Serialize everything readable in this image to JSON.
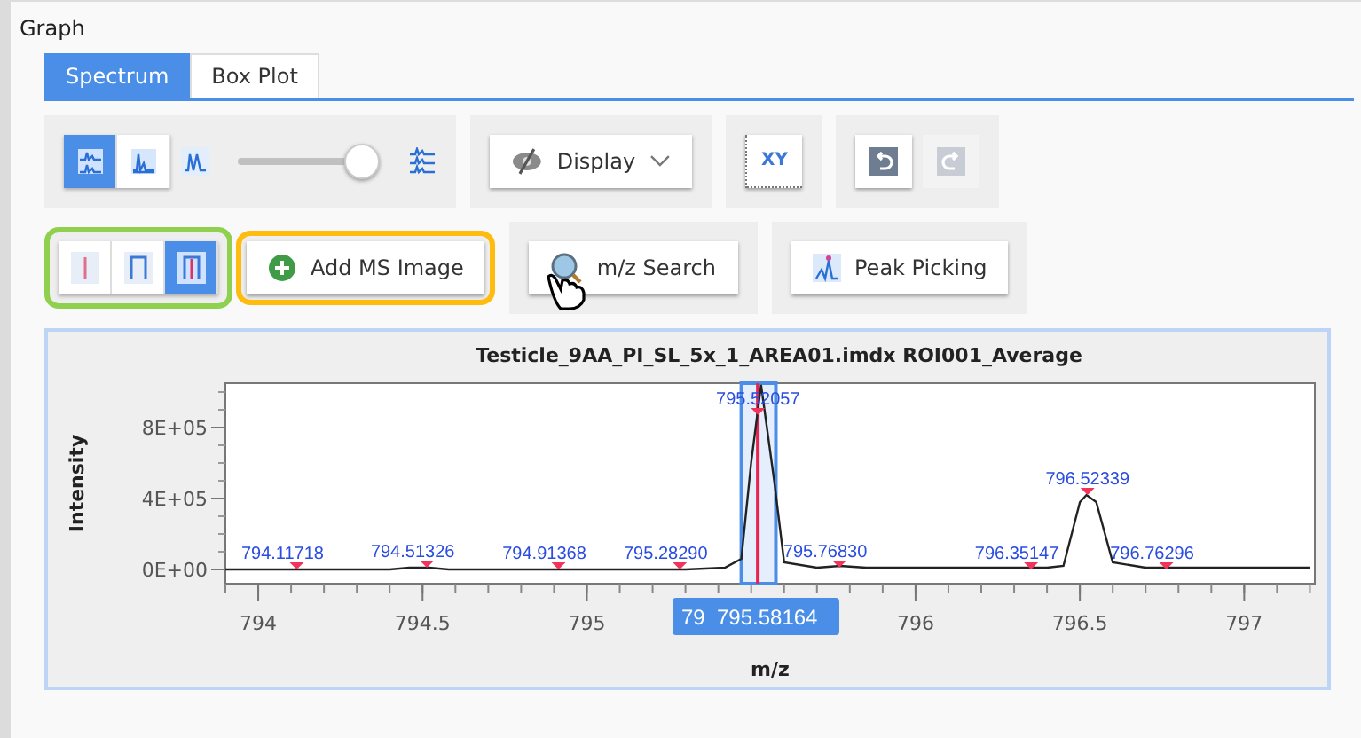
{
  "panel": {
    "title": "Graph"
  },
  "tabs": [
    {
      "label": "Spectrum",
      "selected": true
    },
    {
      "label": "Box Plot",
      "selected": false
    }
  ],
  "toolbar": {
    "view_toggles": [
      {
        "selected": true
      },
      {
        "selected": false
      }
    ],
    "display_button": {
      "label": "Display"
    },
    "axis_button": {
      "label": "XY"
    },
    "undo": {
      "disabled": false
    },
    "redo": {
      "disabled": true
    }
  },
  "mode_group": {
    "highlighted": true,
    "toggles": [
      {
        "selected": false
      },
      {
        "selected": false
      },
      {
        "selected": true
      }
    ]
  },
  "actions": [
    {
      "label": "Add MS Image",
      "highlighted": true
    },
    {
      "label": "m/z Search",
      "highlighted": false
    },
    {
      "label": "Peak Picking",
      "highlighted": false
    }
  ],
  "chart": {
    "cursor_labels": [
      "79",
      "795.58164"
    ],
    "chart_data": {
      "type": "line",
      "title": "Testicle_9AA_PI_SL_5x_1_AREA01.imdx ROI001_Average",
      "xlabel": "m/z",
      "ylabel": "Intensity",
      "x": [
        793.9,
        794.4,
        794.46,
        794.52,
        794.58,
        795.0,
        795.3,
        795.42,
        795.47,
        795.5,
        795.53,
        795.57,
        795.6,
        795.7,
        795.77,
        795.85,
        796.05,
        796.2,
        796.4,
        796.45,
        796.5,
        796.52,
        796.55,
        796.6,
        796.7,
        796.9,
        797.05,
        797.2
      ],
      "series": [
        {
          "color": "#222222",
          "values": [
            0,
            0,
            10000,
            10000,
            0,
            0,
            0,
            10000,
            60000,
            600000,
            1040000,
            500000,
            40000,
            10000,
            20000,
            10000,
            10000,
            10000,
            10000,
            20000,
            380000,
            420000,
            380000,
            40000,
            10000,
            10000,
            10000,
            10000
          ]
        }
      ],
      "xlim": [
        793.9,
        797.215
      ],
      "ylim": [
        -80000,
        1050000
      ],
      "xticks": [
        794,
        794.5,
        795,
        796,
        796.5,
        797
      ],
      "ref_lines": [
        {
          "axis": "x",
          "value": 795.52,
          "color": "#e8244e"
        }
      ],
      "yticks": [
        {
          "value": 0,
          "label": "0E+00"
        },
        {
          "value": 400000,
          "label": "4E+05"
        },
        {
          "value": 800000,
          "label": "8E+05"
        }
      ],
      "annotations": [
        {
          "x": 794.11718,
          "y": 0,
          "text": "794.11718"
        },
        {
          "x": 794.51326,
          "y": 10000,
          "text": "794.51326"
        },
        {
          "x": 794.91368,
          "y": 0,
          "text": "794.91368"
        },
        {
          "x": 795.2829,
          "y": 0,
          "text": "795.28290"
        },
        {
          "x": 795.52057,
          "y": 870000,
          "text": "795.52057"
        },
        {
          "x": 795.7683,
          "y": 10000,
          "text": "795.76830"
        },
        {
          "x": 796.35147,
          "y": 0,
          "text": "796.35147"
        },
        {
          "x": 796.52339,
          "y": 420000,
          "text": "796.52339"
        },
        {
          "x": 796.76296,
          "y": 0,
          "text": "796.76296"
        }
      ]
    }
  }
}
